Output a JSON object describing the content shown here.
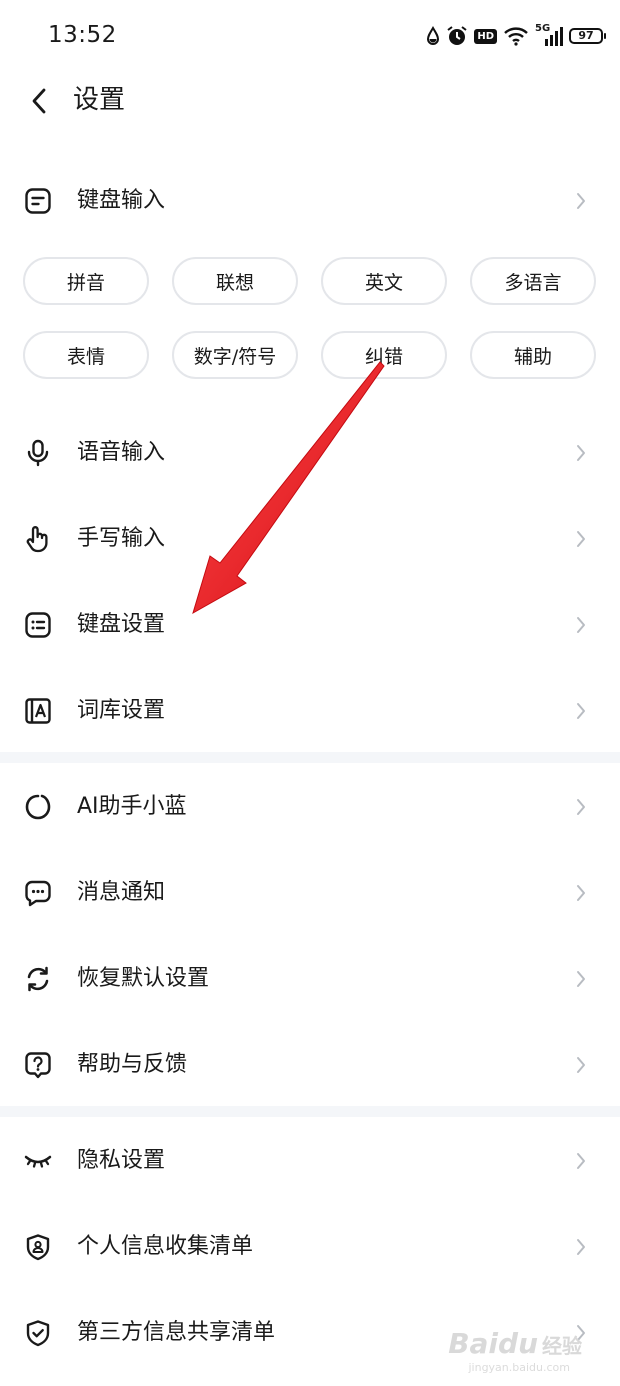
{
  "status_bar": {
    "time": "13:52",
    "network": "5G",
    "battery": "97"
  },
  "header": {
    "title": "设置"
  },
  "sections": [
    {
      "items": [
        {
          "label": "键盘输入",
          "icon": "keyboard-input-icon"
        }
      ],
      "chips": [
        "拼音",
        "联想",
        "英文",
        "多语言",
        "表情",
        "数字/符号",
        "纠错",
        "辅助"
      ],
      "more_items": [
        {
          "label": "语音输入",
          "icon": "microphone-icon"
        },
        {
          "label": "手写输入",
          "icon": "hand-pointer-icon"
        },
        {
          "label": "键盘设置",
          "icon": "keyboard-icon"
        },
        {
          "label": "词库设置",
          "icon": "dictionary-icon"
        }
      ]
    },
    {
      "items": [
        {
          "label": "AI助手小蓝",
          "icon": "ai-assistant-icon"
        },
        {
          "label": "消息通知",
          "icon": "message-icon"
        },
        {
          "label": "恢复默认设置",
          "icon": "refresh-icon"
        },
        {
          "label": "帮助与反馈",
          "icon": "help-icon"
        }
      ]
    },
    {
      "items": [
        {
          "label": "隐私设置",
          "icon": "closed-eye-icon"
        },
        {
          "label": "个人信息收集清单",
          "icon": "shield-user-icon"
        },
        {
          "label": "第三方信息共享清单",
          "icon": "shield-check-icon"
        }
      ]
    }
  ],
  "watermark": {
    "brand": "Baidu",
    "cn": "经验",
    "url": "jingyan.baidu.com"
  },
  "colors": {
    "arrow": "#e8141b",
    "divider": "#f4f6f9",
    "chip_border": "#e4e6ea"
  }
}
